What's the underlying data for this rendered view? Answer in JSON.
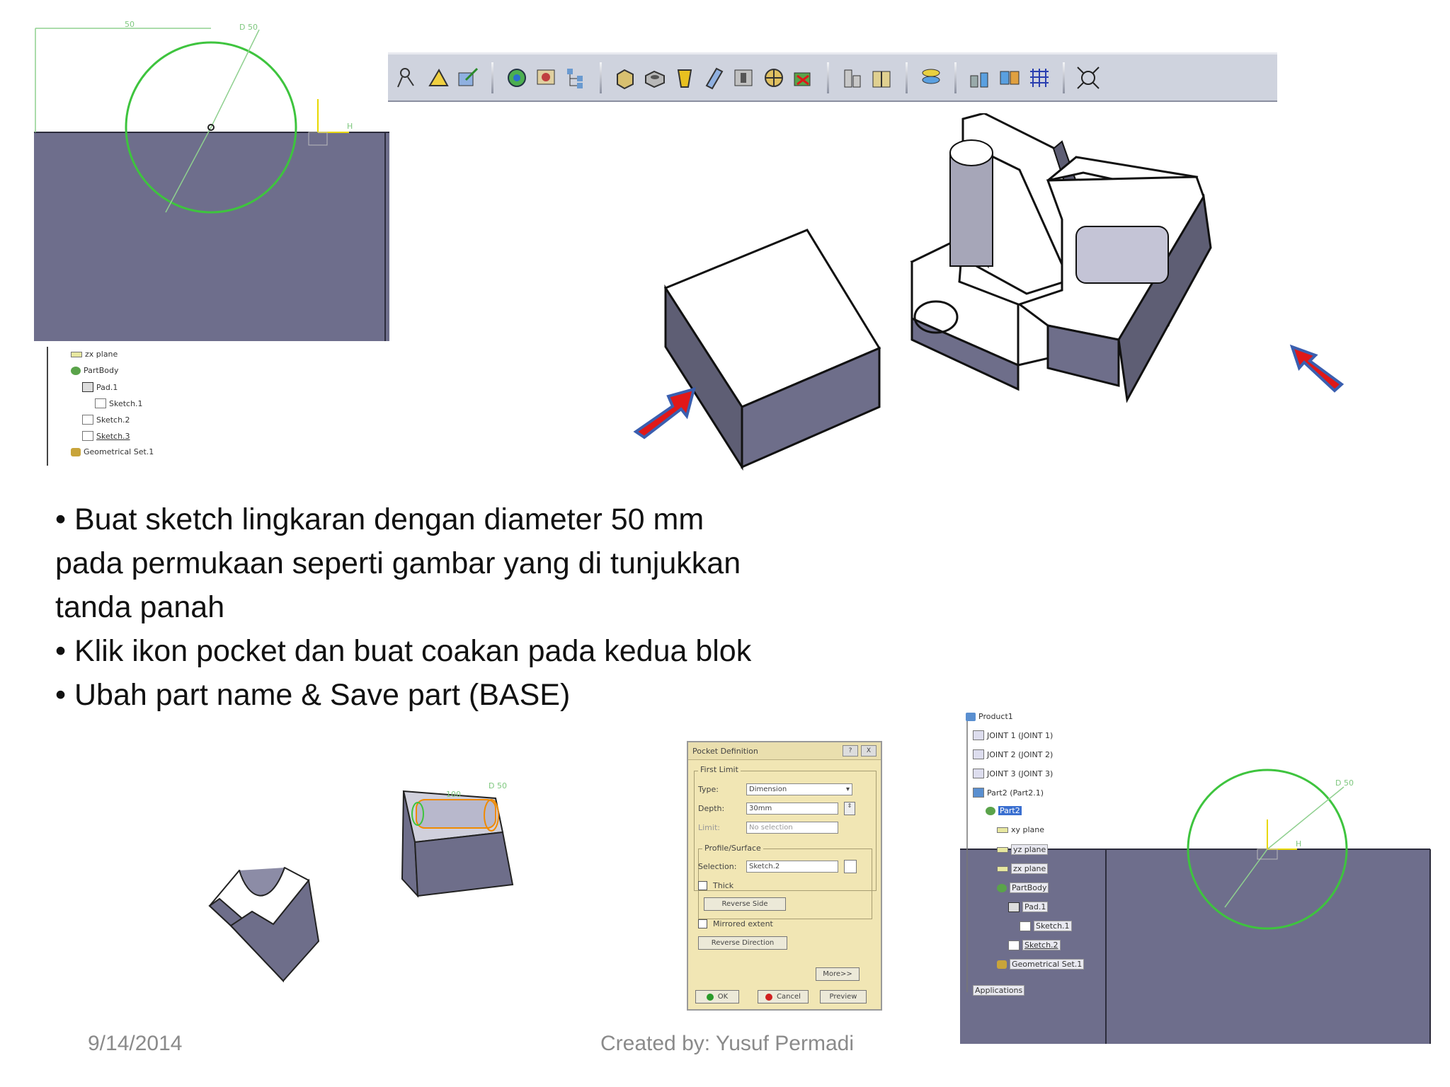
{
  "toolbar": {
    "icons": [
      "sketch-icon",
      "sketch-positioned-icon",
      "exit-workbench-icon",
      "insert-body-icon",
      "mechanical-feature-icon",
      "tree-icon",
      "pad-icon",
      "pocket-icon",
      "shaft-icon",
      "groove-icon",
      "hole-icon",
      "rib-icon",
      "slot-icon",
      "stiffener-icon",
      "solid-combine-icon",
      "multi-sections-icon",
      "surface-icon",
      "measure-icon",
      "knowledge-icon",
      "pattern-icon",
      "fit-all-icon"
    ]
  },
  "sketch_top": {
    "dim_length": "50",
    "dim_diameter": "D 50",
    "axis_label": "H"
  },
  "tree_small": {
    "items": [
      "zx plane",
      "PartBody",
      "Pad.1",
      "Sketch.1",
      "Sketch.2",
      "Sketch.3",
      "Geometrical Set.1"
    ]
  },
  "instructions": {
    "lines": [
      "• Buat sketch lingkaran dengan diameter 50 mm pada permukaan seperti gambar yang di tunjukkan tanda panah",
      "• Klik ikon pocket dan buat coakan pada kedua blok",
      "• Ubah part name & Save part (BASE)"
    ]
  },
  "small_model": {
    "dim_diameter": "D 50",
    "dim_length": "100"
  },
  "dialog": {
    "title": "Pocket Definition",
    "help_btn": "?",
    "close_btn": "X",
    "first_limit": "First Limit",
    "type_label": "Type:",
    "type_value": "Dimension",
    "depth_label": "Depth:",
    "depth_value": "30mm",
    "limit_label": "Limit:",
    "limit_value": "No selection",
    "profile_surface": "Profile/Surface",
    "selection_label": "Selection:",
    "selection_value": "Sketch.2",
    "thick_label": "Thick",
    "reverse_side": "Reverse Side",
    "mirrored_extent": "Mirrored extent",
    "reverse_direction": "Reverse Direction",
    "more": "More>>",
    "ok": "OK",
    "cancel": "Cancel",
    "preview": "Preview"
  },
  "tree_large": {
    "items": [
      "Product1",
      "JOINT 1 (JOINT 1)",
      "JOINT 2 (JOINT 2)",
      "JOINT 3 (JOINT 3)",
      "Part2 (Part2.1)",
      "Part2",
      "xy plane",
      "yz plane",
      "zx plane",
      "PartBody",
      "Pad.1",
      "Sketch.1",
      "Sketch.2",
      "Geometrical Set.1",
      "Applications"
    ],
    "dim_diameter": "D 50",
    "axis_label": "H"
  },
  "footer": {
    "date": "9/14/2014",
    "credit": "Created by: Yusuf Permadi"
  },
  "colors": {
    "block_face": "#6e6e8c",
    "sketch_green": "#3ec43e",
    "arrow_red": "#e01818",
    "arrow_blue": "#3a5fb0",
    "dialog_bg": "#f1e6b4"
  }
}
